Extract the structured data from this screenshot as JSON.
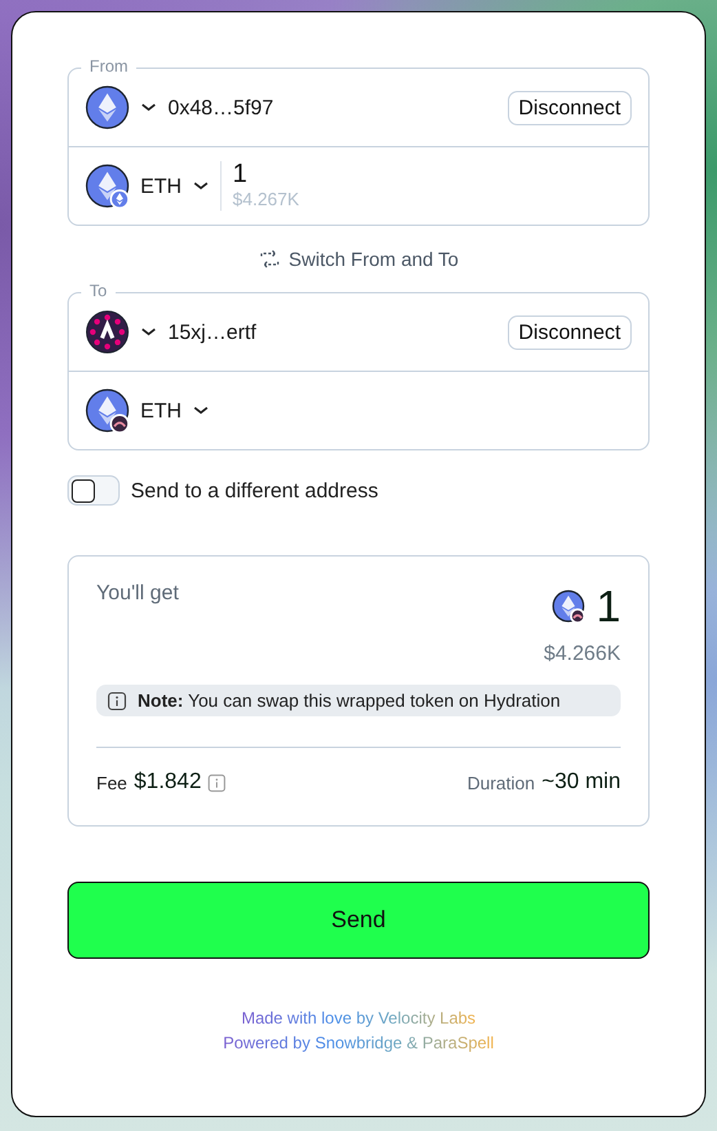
{
  "from": {
    "label": "From",
    "address": "0x48…5f97",
    "disconnect": "Disconnect",
    "token": "ETH",
    "amount": "1",
    "amount_usd": "$4.267K"
  },
  "switch_label": "Switch From and To",
  "to": {
    "label": "To",
    "address": "15xj…ertf",
    "disconnect": "Disconnect",
    "token": "ETH"
  },
  "different_address": {
    "label": "Send to a different address",
    "checked": false
  },
  "result": {
    "title": "You'll get",
    "amount": "1",
    "amount_usd": "$4.266K",
    "note": "**Note:** You can swap this wrapped token on Hydration",
    "fee_label": "Fee",
    "fee": "$1.842",
    "duration_label": "Duration",
    "duration": "~30 min"
  },
  "send_button": "Send",
  "footer": [
    "Made with love by Velocity Labs",
    "Powered by Snowbridge & ParaSpell"
  ]
}
